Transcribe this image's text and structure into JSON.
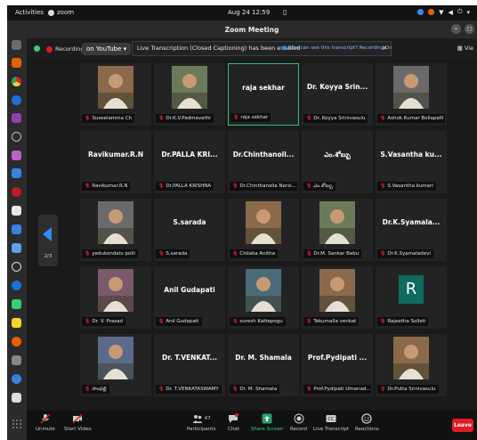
{
  "topbar": {
    "activities": "Activities",
    "app": "zoom",
    "clock": "Aug 24  12:59"
  },
  "window": {
    "title": "Zoom Meeting"
  },
  "infobar": {
    "recording": "Recording",
    "youtube": "on YouTube",
    "caption_message": "Live Transcription (Closed Captioning) has been enabled",
    "caption_link": "Who can see this transcript? Recording On",
    "view": "Vie"
  },
  "pager": {
    "page": "2/3"
  },
  "tiles": [
    {
      "display": "",
      "name": "Suseelamma Ch",
      "has_photo": true
    },
    {
      "display": "",
      "name": "Dr.K.V.Padmavathi",
      "has_photo": true
    },
    {
      "display": "raja sekhar",
      "name": "raja sekhar",
      "has_photo": false
    },
    {
      "display": "Dr. Koyya Srin...",
      "name": "Dr. Koyya Srinivasulu",
      "has_photo": false
    },
    {
      "display": "",
      "name": "Ashok Kumar Bollapalli",
      "has_photo": true
    },
    {
      "display": "Ravikumar.R.N",
      "name": "Ravikumar.R.N",
      "has_photo": false
    },
    {
      "display": "Dr.PALLA KRI...",
      "name": "Dr.PALLA KRISHNA",
      "has_photo": false
    },
    {
      "display": "Dr.Chinthanoll...",
      "name": "Dr.Chinthanolla Narsi...",
      "has_photo": false
    },
    {
      "display": "ఎం.శోబ్బు",
      "name": "ఎం.శోబ్బు",
      "has_photo": false
    },
    {
      "display": "S.Vasantha ku...",
      "name": "S.Vasantha kumari",
      "has_photo": false
    },
    {
      "display": "",
      "name": "yedukondalu polli",
      "has_photo": true
    },
    {
      "display": "S.sarada",
      "name": "S.sarada",
      "has_photo": false
    },
    {
      "display": "",
      "name": "Chilaka Anitha",
      "has_photo": true
    },
    {
      "display": "",
      "name": "Dr.M. Sankar Babu",
      "has_photo": true
    },
    {
      "display": "Dr.K.Syamala...",
      "name": "Dr.K.Syamaladevi",
      "has_photo": false
    },
    {
      "display": "",
      "name": "Dr. V. Prasad",
      "has_photo": true
    },
    {
      "display": "Anil Gudapati",
      "name": "Anil Gudapati",
      "has_photo": false
    },
    {
      "display": "",
      "name": "suresh Kattepogu",
      "has_photo": true
    },
    {
      "display": "",
      "name": "Tekumalla venkat",
      "has_photo": true
    },
    {
      "display": "R",
      "name": "Rajeetha Solleti",
      "has_photo": false
    },
    {
      "display": "",
      "name": "సాంపల్లి",
      "has_photo": true
    },
    {
      "display": "Dr. T.VENKAT...",
      "name": "Dr. T.VENKATASWAMY",
      "has_photo": false
    },
    {
      "display": "Dr. M. Shamala",
      "name": "Dr. M. Shamala",
      "has_photo": false
    },
    {
      "display": "Prof.Pydipati ...",
      "name": "Prof.Pydipati Umanad...",
      "has_photo": false
    },
    {
      "display": "",
      "name": "Dr.Putta Srinivasulu",
      "has_photo": true
    }
  ],
  "toolbar": {
    "unmute": "Unmute",
    "start_video": "Start Video",
    "participants": "Participants",
    "participant_count": "47",
    "chat": "Chat",
    "share_screen": "Share Screen",
    "record": "Record",
    "live_transcript": "Live Transcript",
    "reactions": "Reactions",
    "leave": "Leave"
  },
  "colors": {
    "accent_green": "#2ec27e",
    "share_green": "#26a269",
    "leave_red": "#e01b24",
    "zoom_blue": "#2f8cff"
  }
}
